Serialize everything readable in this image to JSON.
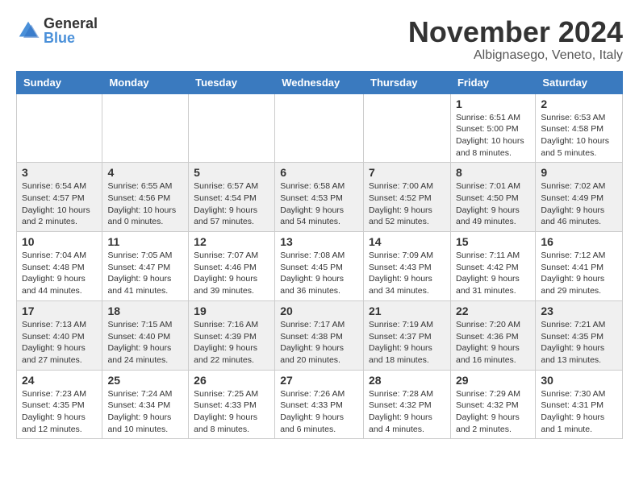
{
  "logo": {
    "general": "General",
    "blue": "Blue"
  },
  "title": "November 2024",
  "location": "Albignasego, Veneto, Italy",
  "weekdays": [
    "Sunday",
    "Monday",
    "Tuesday",
    "Wednesday",
    "Thursday",
    "Friday",
    "Saturday"
  ],
  "weeks": [
    [
      {
        "day": "",
        "info": ""
      },
      {
        "day": "",
        "info": ""
      },
      {
        "day": "",
        "info": ""
      },
      {
        "day": "",
        "info": ""
      },
      {
        "day": "",
        "info": ""
      },
      {
        "day": "1",
        "info": "Sunrise: 6:51 AM\nSunset: 5:00 PM\nDaylight: 10 hours and 8 minutes."
      },
      {
        "day": "2",
        "info": "Sunrise: 6:53 AM\nSunset: 4:58 PM\nDaylight: 10 hours and 5 minutes."
      }
    ],
    [
      {
        "day": "3",
        "info": "Sunrise: 6:54 AM\nSunset: 4:57 PM\nDaylight: 10 hours and 2 minutes."
      },
      {
        "day": "4",
        "info": "Sunrise: 6:55 AM\nSunset: 4:56 PM\nDaylight: 10 hours and 0 minutes."
      },
      {
        "day": "5",
        "info": "Sunrise: 6:57 AM\nSunset: 4:54 PM\nDaylight: 9 hours and 57 minutes."
      },
      {
        "day": "6",
        "info": "Sunrise: 6:58 AM\nSunset: 4:53 PM\nDaylight: 9 hours and 54 minutes."
      },
      {
        "day": "7",
        "info": "Sunrise: 7:00 AM\nSunset: 4:52 PM\nDaylight: 9 hours and 52 minutes."
      },
      {
        "day": "8",
        "info": "Sunrise: 7:01 AM\nSunset: 4:50 PM\nDaylight: 9 hours and 49 minutes."
      },
      {
        "day": "9",
        "info": "Sunrise: 7:02 AM\nSunset: 4:49 PM\nDaylight: 9 hours and 46 minutes."
      }
    ],
    [
      {
        "day": "10",
        "info": "Sunrise: 7:04 AM\nSunset: 4:48 PM\nDaylight: 9 hours and 44 minutes."
      },
      {
        "day": "11",
        "info": "Sunrise: 7:05 AM\nSunset: 4:47 PM\nDaylight: 9 hours and 41 minutes."
      },
      {
        "day": "12",
        "info": "Sunrise: 7:07 AM\nSunset: 4:46 PM\nDaylight: 9 hours and 39 minutes."
      },
      {
        "day": "13",
        "info": "Sunrise: 7:08 AM\nSunset: 4:45 PM\nDaylight: 9 hours and 36 minutes."
      },
      {
        "day": "14",
        "info": "Sunrise: 7:09 AM\nSunset: 4:43 PM\nDaylight: 9 hours and 34 minutes."
      },
      {
        "day": "15",
        "info": "Sunrise: 7:11 AM\nSunset: 4:42 PM\nDaylight: 9 hours and 31 minutes."
      },
      {
        "day": "16",
        "info": "Sunrise: 7:12 AM\nSunset: 4:41 PM\nDaylight: 9 hours and 29 minutes."
      }
    ],
    [
      {
        "day": "17",
        "info": "Sunrise: 7:13 AM\nSunset: 4:40 PM\nDaylight: 9 hours and 27 minutes."
      },
      {
        "day": "18",
        "info": "Sunrise: 7:15 AM\nSunset: 4:40 PM\nDaylight: 9 hours and 24 minutes."
      },
      {
        "day": "19",
        "info": "Sunrise: 7:16 AM\nSunset: 4:39 PM\nDaylight: 9 hours and 22 minutes."
      },
      {
        "day": "20",
        "info": "Sunrise: 7:17 AM\nSunset: 4:38 PM\nDaylight: 9 hours and 20 minutes."
      },
      {
        "day": "21",
        "info": "Sunrise: 7:19 AM\nSunset: 4:37 PM\nDaylight: 9 hours and 18 minutes."
      },
      {
        "day": "22",
        "info": "Sunrise: 7:20 AM\nSunset: 4:36 PM\nDaylight: 9 hours and 16 minutes."
      },
      {
        "day": "23",
        "info": "Sunrise: 7:21 AM\nSunset: 4:35 PM\nDaylight: 9 hours and 13 minutes."
      }
    ],
    [
      {
        "day": "24",
        "info": "Sunrise: 7:23 AM\nSunset: 4:35 PM\nDaylight: 9 hours and 12 minutes."
      },
      {
        "day": "25",
        "info": "Sunrise: 7:24 AM\nSunset: 4:34 PM\nDaylight: 9 hours and 10 minutes."
      },
      {
        "day": "26",
        "info": "Sunrise: 7:25 AM\nSunset: 4:33 PM\nDaylight: 9 hours and 8 minutes."
      },
      {
        "day": "27",
        "info": "Sunrise: 7:26 AM\nSunset: 4:33 PM\nDaylight: 9 hours and 6 minutes."
      },
      {
        "day": "28",
        "info": "Sunrise: 7:28 AM\nSunset: 4:32 PM\nDaylight: 9 hours and 4 minutes."
      },
      {
        "day": "29",
        "info": "Sunrise: 7:29 AM\nSunset: 4:32 PM\nDaylight: 9 hours and 2 minutes."
      },
      {
        "day": "30",
        "info": "Sunrise: 7:30 AM\nSunset: 4:31 PM\nDaylight: 9 hours and 1 minute."
      }
    ]
  ]
}
